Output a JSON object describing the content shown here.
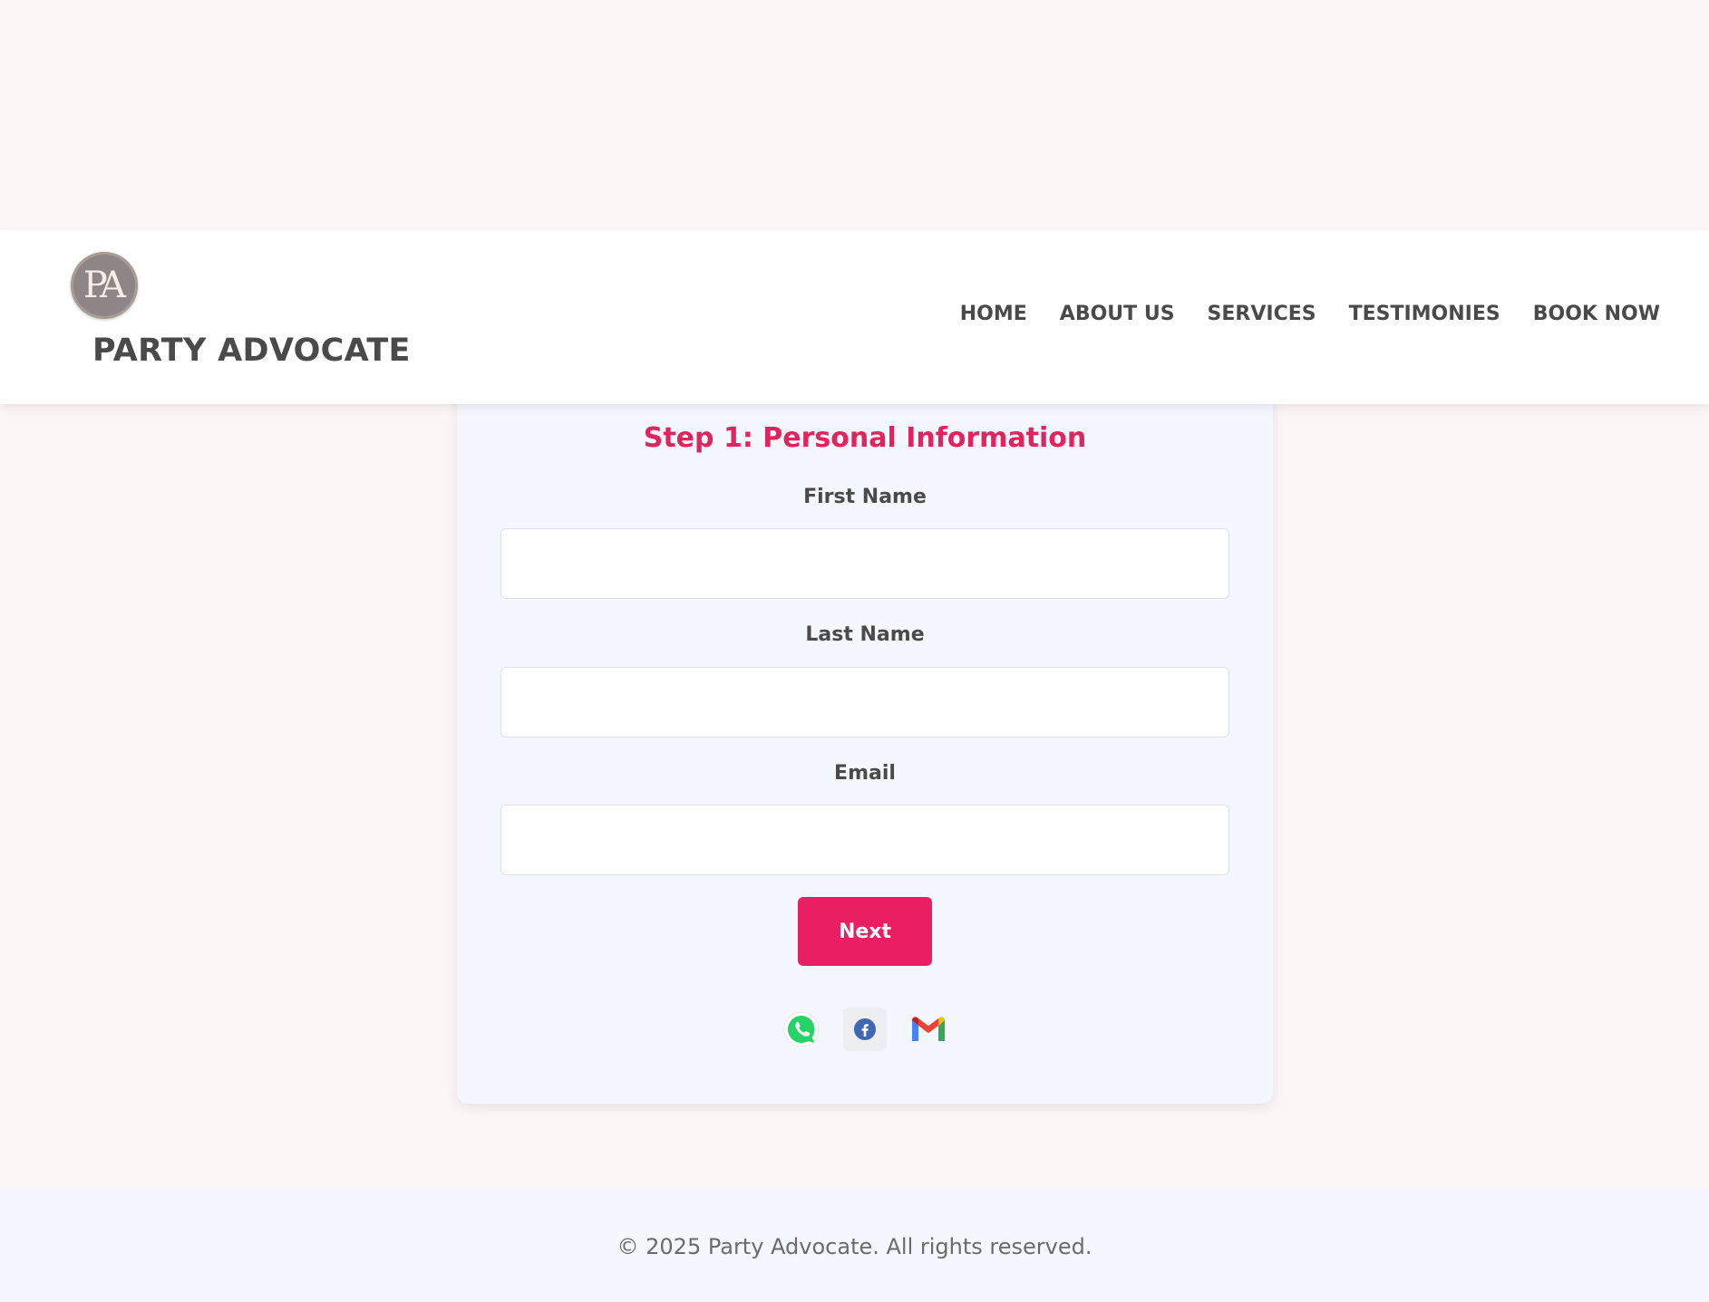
{
  "brand": {
    "logo_monogram": "PA",
    "name": "PARTY ADVOCATE"
  },
  "nav": {
    "items": [
      {
        "label": "HOME"
      },
      {
        "label": "ABOUT US"
      },
      {
        "label": "SERVICES"
      },
      {
        "label": "TESTIMONIES"
      },
      {
        "label": "BOOK NOW"
      }
    ]
  },
  "form": {
    "step_title": "Step 1: Personal Information",
    "fields": [
      {
        "label": "First Name",
        "value": "",
        "placeholder": ""
      },
      {
        "label": "Last Name",
        "value": "",
        "placeholder": ""
      },
      {
        "label": "Email",
        "value": "",
        "placeholder": ""
      }
    ],
    "next_label": "Next"
  },
  "socials": [
    {
      "icon": "whatsapp-icon"
    },
    {
      "icon": "facebook-icon"
    },
    {
      "icon": "gmail-icon"
    }
  ],
  "footer": {
    "copyright": "© 2025 Party Advocate. All rights reserved."
  },
  "colors": {
    "accent": "#e91e63",
    "title_accent": "#e0245e",
    "page_bg": "#fdf6f6",
    "card_bg": "#f4f7fd",
    "text_dark": "#4a4a4a"
  }
}
